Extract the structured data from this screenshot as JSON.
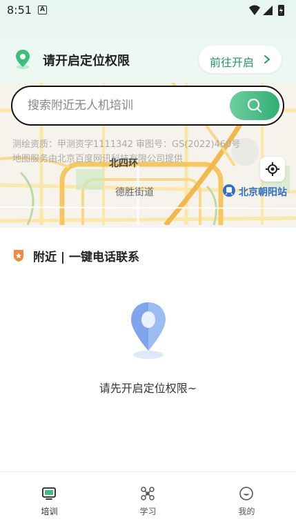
{
  "status_bar": {
    "time": "8:51",
    "notification_glyph": "A"
  },
  "location_banner": {
    "text": "请开启定位权限",
    "button_label": "前往开启"
  },
  "search": {
    "placeholder": "搜索附近无人机培训"
  },
  "map": {
    "credit_line1": "测绘资质：甲测资字1111342 审图号：GS(2022)460号",
    "credit_line2": "地图服务由北京百度网讯科技有限公司提供",
    "road_label_west": "北四环",
    "road_label_desheng": "德胜街道",
    "station_label": "北京朝阳站"
  },
  "nearby": {
    "title": "附近 | 一键电话联系",
    "empty_text": "请先开启定位权限~"
  },
  "tabs": [
    {
      "label": "培训",
      "icon": "training-tv-icon",
      "active": true
    },
    {
      "label": "学习",
      "icon": "drone-icon",
      "active": false
    },
    {
      "label": "我的",
      "icon": "smiley-icon",
      "active": false
    }
  ],
  "colors": {
    "accent": "#2fae73",
    "accent_light": "#6fcf9e",
    "text": "#222222",
    "station": "#2f6fd0"
  }
}
